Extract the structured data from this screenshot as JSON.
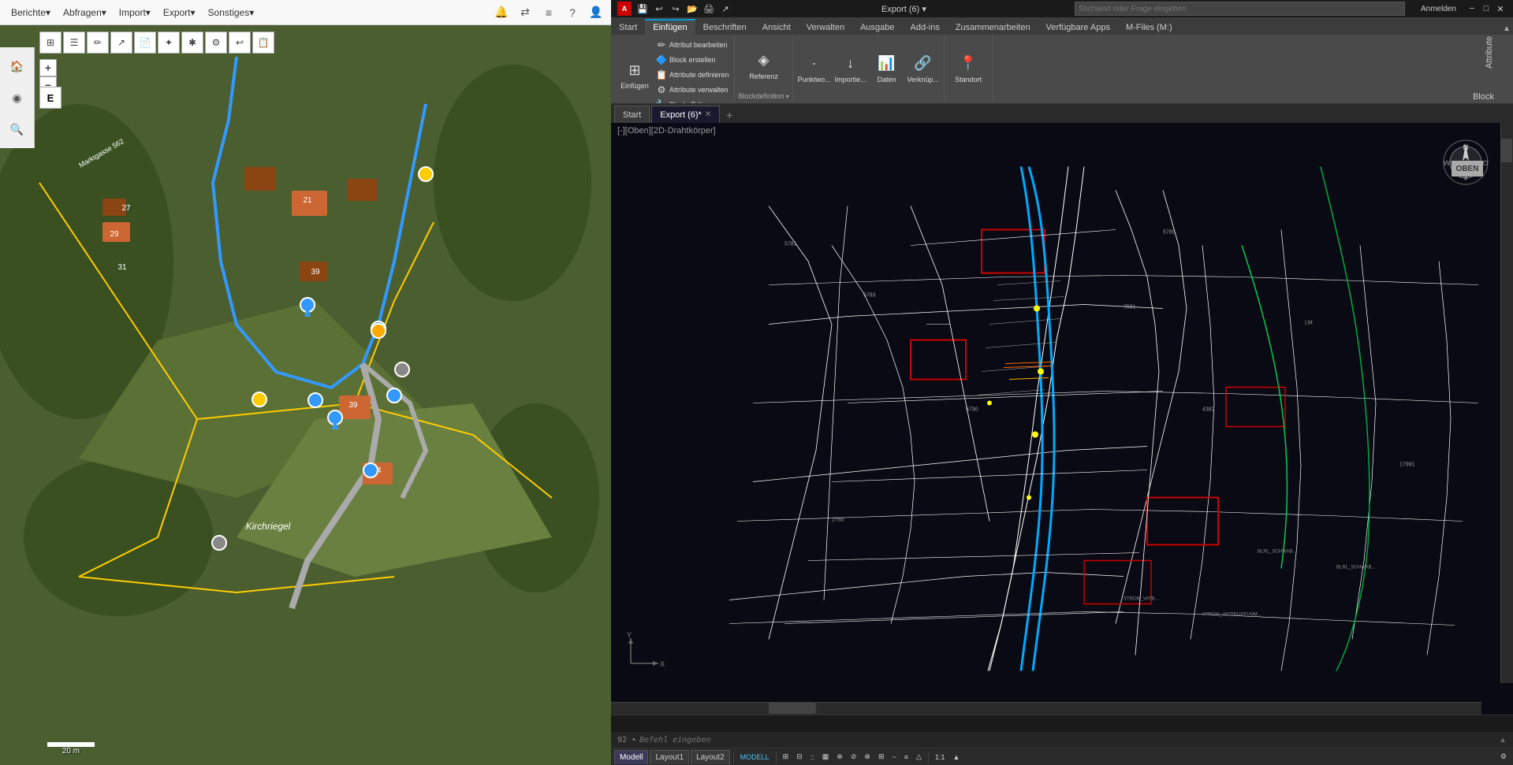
{
  "left_panel": {
    "nav": {
      "items": [
        {
          "label": "Berichte▾",
          "id": "berichte"
        },
        {
          "label": "Abfragen▾",
          "id": "abfragen"
        },
        {
          "label": "Import▾",
          "id": "import"
        },
        {
          "label": "Export▾",
          "id": "export"
        },
        {
          "label": "Sonstiges▾",
          "id": "sonstiges"
        }
      ]
    },
    "map_tools": [
      "+",
      "-"
    ],
    "toolbar_buttons": [
      "⊞",
      "☰",
      "✏",
      "↗",
      "📄",
      "✦",
      "✱",
      "⚙",
      "↩",
      "📋"
    ],
    "e_button": "E",
    "scale": "20 m",
    "location_label": "Kirchriegel",
    "street_label": "Marktgasse 562"
  },
  "right_panel": {
    "titlebar": {
      "title": "Export (6) ▾",
      "search_placeholder": "Stichwort oder Frage eingeben",
      "user": "Anmelden",
      "window_buttons": [
        "−",
        "□",
        "✕"
      ]
    },
    "quick_access_icons": [
      "💾",
      "↩",
      "↪",
      "📂",
      "🖨",
      "↗"
    ],
    "ribbon_tabs": [
      {
        "label": "Start",
        "active": false
      },
      {
        "label": "Einfügen",
        "active": true
      },
      {
        "label": "Beschriften",
        "active": false
      },
      {
        "label": "Ansicht",
        "active": false
      },
      {
        "label": "Verwalten",
        "active": false
      },
      {
        "label": "Ausgabe",
        "active": false
      },
      {
        "label": "Add-ins",
        "active": false
      },
      {
        "label": "Zusammenarbeiten",
        "active": false
      },
      {
        "label": "Verfügbare Apps",
        "active": false
      },
      {
        "label": "M-Files (M:)",
        "active": false
      }
    ],
    "ribbon_groups": [
      {
        "label": "Block ▾",
        "buttons": [
          {
            "icon": "⊞",
            "label": "Einfügen"
          },
          {
            "icon": "✏",
            "label": "Attribut bearbeiten"
          },
          {
            "icon": "🔷",
            "label": "Block erstellen"
          },
          {
            "icon": "📋",
            "label": "Attribute definieren"
          },
          {
            "icon": "⚙",
            "label": "Attribute verwalten"
          },
          {
            "icon": "🔧",
            "label": "Block- Editor"
          }
        ]
      },
      {
        "label": "Blockdefinition ▾",
        "buttons": [
          {
            "icon": "◈",
            "label": "Referenz"
          }
        ]
      },
      {
        "label": "",
        "buttons": [
          {
            "icon": "·",
            "label": "Punktwo..."
          },
          {
            "icon": "↓",
            "label": "Importie..."
          },
          {
            "icon": "📊",
            "label": "Daten"
          },
          {
            "icon": "🔗",
            "label": "Verknüp..."
          }
        ]
      },
      {
        "label": "",
        "buttons": [
          {
            "icon": "📍",
            "label": "Standort"
          }
        ]
      }
    ],
    "drawing_tabs": [
      {
        "label": "Start",
        "active": false
      },
      {
        "label": "Export (6)*",
        "active": true
      }
    ],
    "view_label": "[-][Oben][2D-Drahtkörper]",
    "compass": {
      "N": "N",
      "S": "S",
      "W": "W",
      "O": "O"
    },
    "oben_btn": "OBEN",
    "layout_tabs": [
      {
        "label": "Modell",
        "active": true
      },
      {
        "label": "Layout1",
        "active": false
      },
      {
        "label": "Layout2",
        "active": false
      }
    ],
    "status_items": [
      {
        "label": "MODELL",
        "active": true
      },
      {
        "label": "⊞⊞",
        "active": false
      },
      {
        "label": "⊟",
        "active": false
      },
      {
        "label": "::",
        "active": false
      },
      {
        "label": "▦",
        "active": false
      },
      {
        "label": "⊕",
        "active": false
      },
      {
        "label": "⊘",
        "active": false
      },
      {
        "label": "⊗",
        "active": false
      },
      {
        "label": "⊞",
        "active": false
      },
      {
        "label": "~",
        "active": false
      },
      {
        "label": "≡",
        "active": false
      },
      {
        "label": "△",
        "active": false
      },
      {
        "label": "1:1",
        "active": false
      },
      {
        "label": "▲",
        "active": false
      }
    ],
    "cmd_prompt": "92 •",
    "cmd_placeholder": "Befehl eingeben",
    "attribute_label": "Attribute",
    "block_label": "Block"
  }
}
